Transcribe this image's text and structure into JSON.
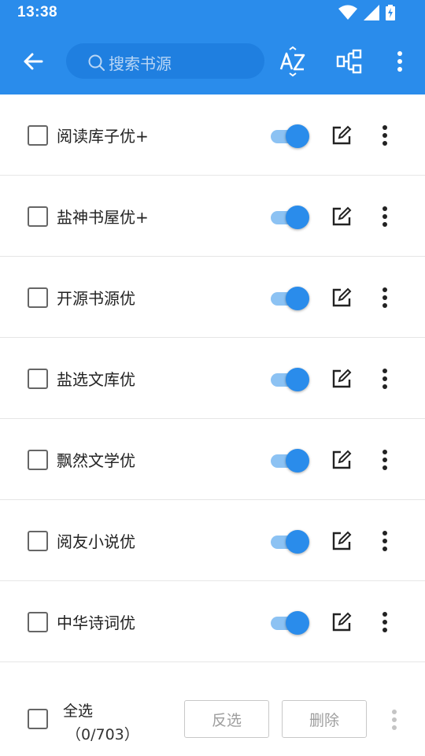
{
  "status": {
    "time": "13:38"
  },
  "toolbar": {
    "search_placeholder": "搜索书源",
    "back_icon": "arrow-left-icon",
    "sort_icon": "sort-az-icon",
    "group_icon": "group-tree-icon",
    "menu_icon": "more-vert-icon"
  },
  "sources": [
    {
      "name": "阅读库子优+",
      "enabled": true
    },
    {
      "name": "盐神书屋优+",
      "enabled": true
    },
    {
      "name": "开源书源优",
      "enabled": true
    },
    {
      "name": "盐选文库优",
      "enabled": true
    },
    {
      "name": "飘然文学优",
      "enabled": true
    },
    {
      "name": "阅友小说优",
      "enabled": true
    },
    {
      "name": "中华诗词优",
      "enabled": true
    }
  ],
  "bottom": {
    "select_all": "全选",
    "count": "（0/703）",
    "invert": "反选",
    "delete": "删除"
  },
  "colors": {
    "primary": "#2a8ceb",
    "switch_track": "#8cc2f3"
  }
}
